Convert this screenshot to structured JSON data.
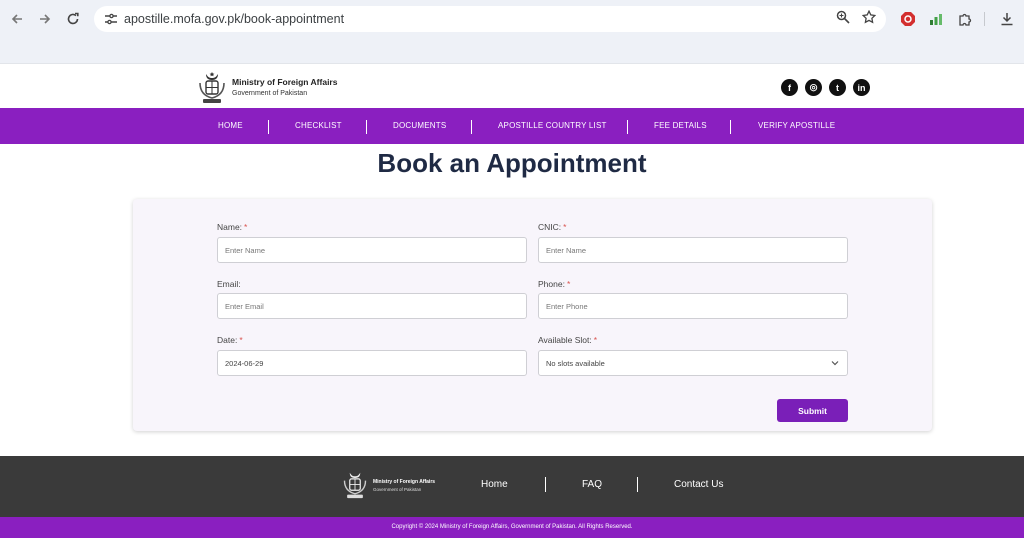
{
  "browser": {
    "url": "apostille.mofa.gov.pk/book-appointment"
  },
  "header": {
    "org_name": "Ministry of Foreign Affairs",
    "gov_name": "Government of Pakistan",
    "socials": [
      {
        "name": "facebook",
        "glyph": "f"
      },
      {
        "name": "instagram",
        "glyph": "◎"
      },
      {
        "name": "twitter",
        "glyph": "t"
      },
      {
        "name": "linkedin",
        "glyph": "in"
      }
    ]
  },
  "nav": {
    "items": [
      "HOME",
      "CHECKLIST",
      "DOCUMENTS",
      "APOSTILLE COUNTRY LIST",
      "FEE DETAILS",
      "VERIFY APOSTILLE"
    ]
  },
  "page": {
    "title": "Book an Appointment"
  },
  "form": {
    "name_label": "Name:",
    "name_placeholder": "Enter Name",
    "cnic_label": "CNIC:",
    "cnic_placeholder": "Enter Name",
    "email_label": "Email:",
    "email_placeholder": "Enter Email",
    "phone_label": "Phone:",
    "phone_placeholder": "Enter Phone",
    "date_label": "Date:",
    "date_value": "2024-06-29",
    "slot_label": "Available Slot:",
    "slot_value": "No slots available",
    "required_mark": "*",
    "submit_label": "Submit"
  },
  "footer": {
    "org_name": "Ministry of Foreign Affairs",
    "gov_name": "Government of Pakistan",
    "links": [
      "Home",
      "FAQ",
      "Contact Us"
    ],
    "copyright": "Copyright © 2024 Ministry of Foreign Affairs, Government of Pakistan. All Rights Reserved."
  },
  "colors": {
    "brand_purple": "#8a1fc0",
    "submit_purple": "#7a1fb8",
    "title_navy": "#1f2a44",
    "footer_dark": "#3a3a3a"
  }
}
